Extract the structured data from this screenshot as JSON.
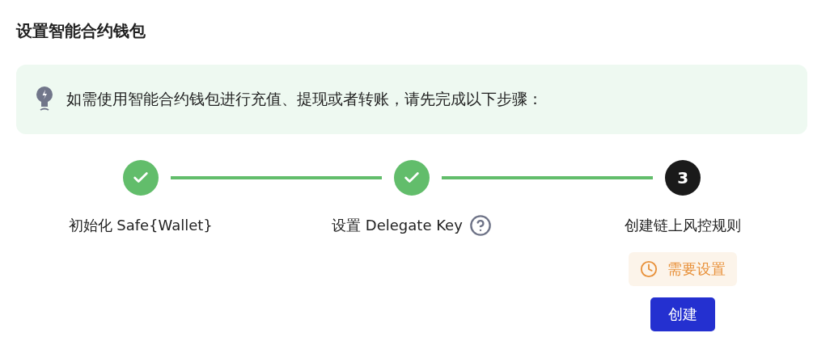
{
  "title": "设置智能合约钱包",
  "notice": {
    "text": "如需使用智能合约钱包进行充值、提现或者转账，请先完成以下步骤："
  },
  "steps": [
    {
      "label": "初始化 Safe{Wallet}",
      "done": true,
      "help": false
    },
    {
      "label": "设置 Delegate Key",
      "done": true,
      "help": true
    },
    {
      "label": "创建链上风控规则",
      "done": false,
      "help": false,
      "number": "3",
      "status_badge": "需要设置",
      "action": "创建"
    }
  ]
}
